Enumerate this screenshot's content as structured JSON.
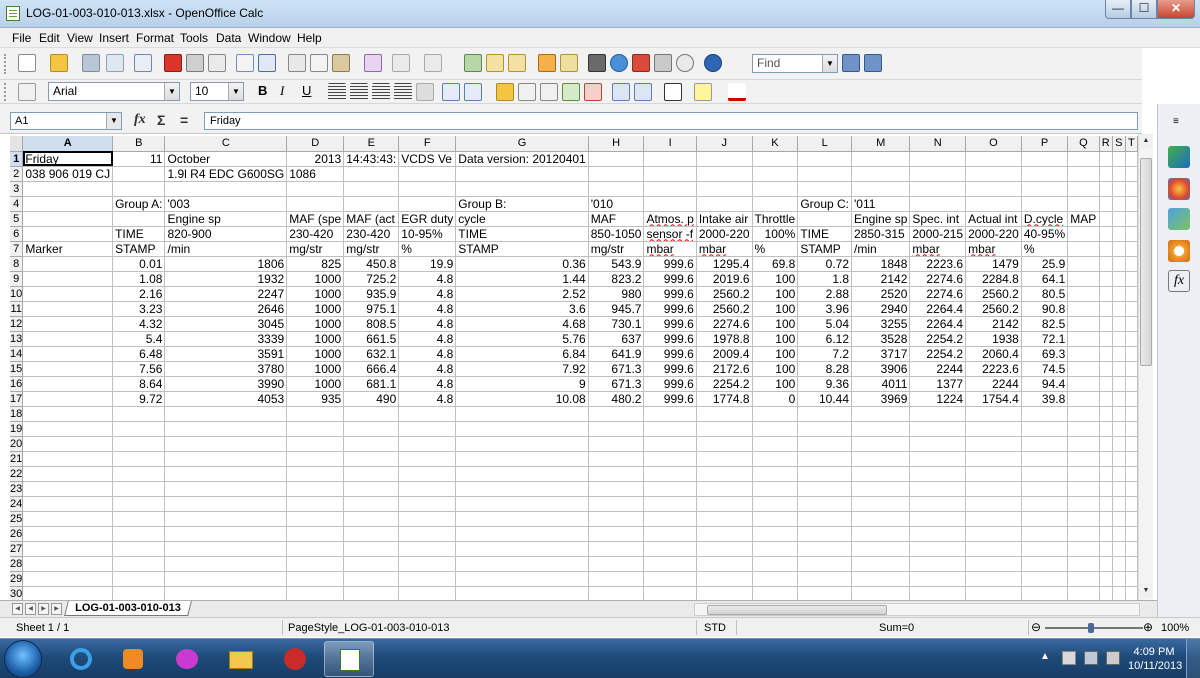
{
  "window": {
    "title": "LOG-01-003-010-013.xlsx - OpenOffice Calc",
    "min": "—",
    "max": "☐",
    "close": "✕"
  },
  "menu": [
    "File",
    "Edit",
    "View",
    "Insert",
    "Format",
    "Tools",
    "Data",
    "Window",
    "Help"
  ],
  "toolbar": {
    "find_placeholder": "Find",
    "font_name": "Arial",
    "font_size": "10",
    "bold": "B",
    "italic": "I",
    "underline": "U"
  },
  "formula_bar": {
    "cell_ref": "A1",
    "content": "Friday",
    "fx": "fx",
    "sum": "Σ",
    "eq": "="
  },
  "sheet": {
    "columns": [
      "A",
      "B",
      "C",
      "D",
      "E",
      "F",
      "G",
      "H",
      "I",
      "J",
      "K",
      "L",
      "M",
      "N",
      "O",
      "P",
      "Q",
      "R",
      "S",
      "T"
    ],
    "rows": [
      [
        "Friday",
        "11",
        "October",
        "2013",
        "14:43:43:",
        "VCDS Ve",
        "Data version: 20120401",
        "",
        "",
        "",
        "",
        "",
        "",
        "",
        "",
        "",
        "",
        "",
        "",
        ""
      ],
      [
        "038 906 019 CJ",
        "",
        "1.9l R4 EDC G600SG",
        "1086",
        "",
        "",
        "",
        "",
        "",
        "",
        "",
        "",
        "",
        "",
        "",
        "",
        "",
        "",
        "",
        ""
      ],
      [
        "",
        "",
        "",
        "",
        "",
        "",
        "",
        "",
        "",
        "",
        "",
        "",
        "",
        "",
        "",
        "",
        "",
        "",
        "",
        ""
      ],
      [
        "",
        "Group A:",
        "'003",
        "",
        "",
        "",
        "Group B:",
        "'010",
        "",
        "",
        "",
        "Group C:",
        "'011",
        "",
        "",
        "",
        "",
        "",
        "",
        ""
      ],
      [
        "",
        "",
        "Engine sp",
        "MAF (spe",
        "MAF (act",
        "EGR duty",
        "cycle",
        "MAF",
        "Atmos. p",
        "Intake air",
        "Throttle",
        "",
        "Engine sp",
        "Spec. int",
        "Actual int",
        "D.cycle",
        "MAP",
        "",
        "",
        ""
      ],
      [
        "",
        "TIME",
        "820-900",
        "230-420",
        "230-420",
        "10-95%",
        "TIME",
        "850-1050",
        "sensor -f",
        "2000-220",
        "100%",
        "TIME",
        "2850-315",
        "2000-215",
        "2000-220",
        "40-95%",
        "",
        "",
        "",
        ""
      ],
      [
        "Marker",
        "STAMP",
        "/min",
        "mg/str",
        "mg/str",
        "%",
        "STAMP",
        "mg/str",
        "mbar",
        "mbar",
        "%",
        "STAMP",
        "/min",
        "mbar",
        "mbar",
        "%",
        "",
        "",
        "",
        ""
      ],
      [
        "",
        "0.01",
        "1806",
        "825",
        "450.8",
        "19.9",
        "0.36",
        "543.9",
        "999.6",
        "1295.4",
        "69.8",
        "0.72",
        "1848",
        "2223.6",
        "1479",
        "25.9",
        "",
        "",
        "",
        ""
      ],
      [
        "",
        "1.08",
        "1932",
        "1000",
        "725.2",
        "4.8",
        "1.44",
        "823.2",
        "999.6",
        "2019.6",
        "100",
        "1.8",
        "2142",
        "2274.6",
        "2284.8",
        "64.1",
        "",
        "",
        "",
        ""
      ],
      [
        "",
        "2.16",
        "2247",
        "1000",
        "935.9",
        "4.8",
        "2.52",
        "980",
        "999.6",
        "2560.2",
        "100",
        "2.88",
        "2520",
        "2274.6",
        "2560.2",
        "80.5",
        "",
        "",
        "",
        ""
      ],
      [
        "",
        "3.23",
        "2646",
        "1000",
        "975.1",
        "4.8",
        "3.6",
        "945.7",
        "999.6",
        "2560.2",
        "100",
        "3.96",
        "2940",
        "2264.4",
        "2560.2",
        "90.8",
        "",
        "",
        "",
        ""
      ],
      [
        "",
        "4.32",
        "3045",
        "1000",
        "808.5",
        "4.8",
        "4.68",
        "730.1",
        "999.6",
        "2274.6",
        "100",
        "5.04",
        "3255",
        "2264.4",
        "2142",
        "82.5",
        "",
        "",
        "",
        ""
      ],
      [
        "",
        "5.4",
        "3339",
        "1000",
        "661.5",
        "4.8",
        "5.76",
        "637",
        "999.6",
        "1978.8",
        "100",
        "6.12",
        "3528",
        "2254.2",
        "1938",
        "72.1",
        "",
        "",
        "",
        ""
      ],
      [
        "",
        "6.48",
        "3591",
        "1000",
        "632.1",
        "4.8",
        "6.84",
        "641.9",
        "999.6",
        "2009.4",
        "100",
        "7.2",
        "3717",
        "2254.2",
        "2060.4",
        "69.3",
        "",
        "",
        "",
        ""
      ],
      [
        "",
        "7.56",
        "3780",
        "1000",
        "666.4",
        "4.8",
        "7.92",
        "671.3",
        "999.6",
        "2172.6",
        "100",
        "8.28",
        "3906",
        "2244",
        "2223.6",
        "74.5",
        "",
        "",
        "",
        ""
      ],
      [
        "",
        "8.64",
        "3990",
        "1000",
        "681.1",
        "4.8",
        "9",
        "671.3",
        "999.6",
        "2254.2",
        "100",
        "9.36",
        "4011",
        "1377",
        "2244",
        "94.4",
        "",
        "",
        "",
        ""
      ],
      [
        "",
        "9.72",
        "4053",
        "935",
        "490",
        "4.8",
        "10.08",
        "480.2",
        "999.6",
        "1774.8",
        "0",
        "10.44",
        "3969",
        "1224",
        "1754.4",
        "39.8",
        "",
        "",
        "",
        ""
      ]
    ],
    "total_rows": 30,
    "tab_name": "LOG-01-003-010-013"
  },
  "status": {
    "sheet": "Sheet 1 / 1",
    "page_style": "PageStyle_LOG-01-003-010-013",
    "mode": "STD",
    "sum": "Sum=0",
    "zoom": "100%",
    "zoom_minus": "⊖",
    "zoom_plus": "⊕"
  },
  "taskbar": {
    "time": "4:09 PM",
    "date": "10/11/2013"
  }
}
